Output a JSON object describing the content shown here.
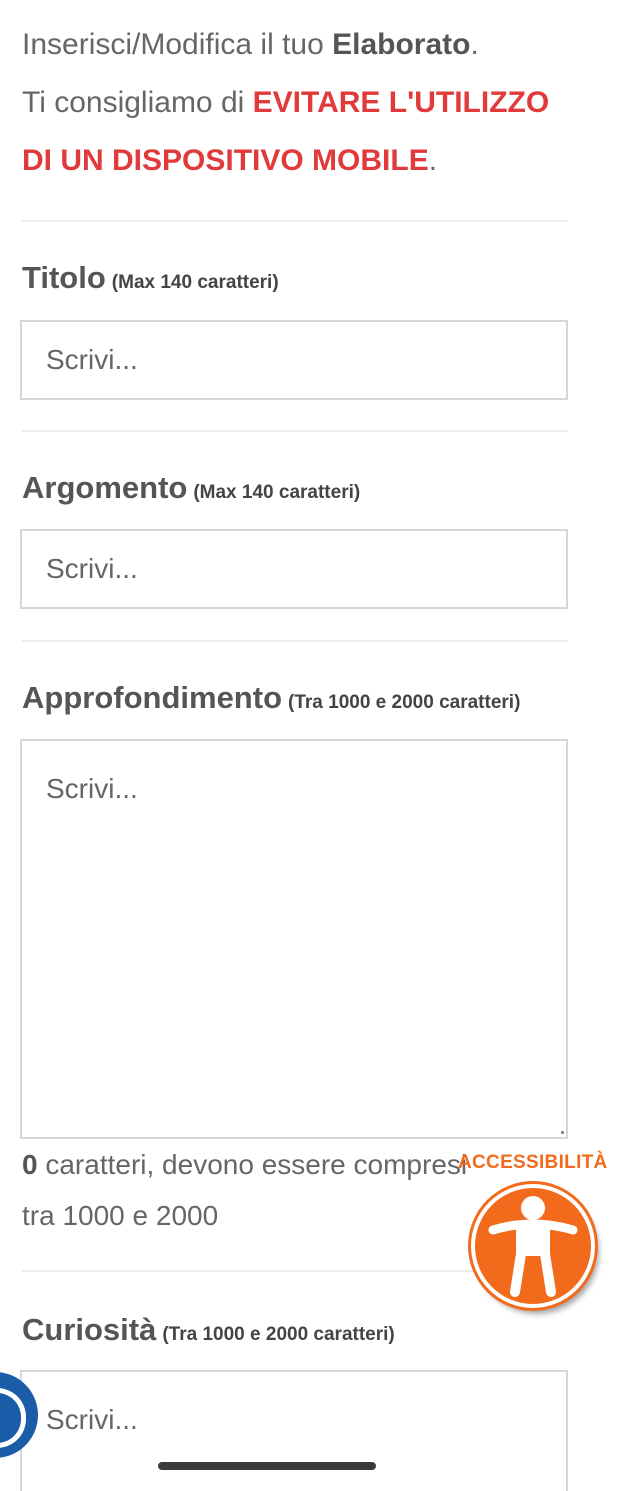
{
  "intro": {
    "line1_prefix": "Inserisci/Modifica il tuo ",
    "line1_bold": "Elaborato",
    "line1_suffix": ".",
    "line2_prefix": "Ti consigliamo di ",
    "line2_red": "EVITARE L'UTILIZZO",
    "line3_red": "DI UN DISPOSITIVO MOBILE",
    "line3_suffix": "."
  },
  "fields": {
    "titolo": {
      "label": "Titolo",
      "hint": "(Max 140 caratteri)",
      "placeholder": "Scrivi..."
    },
    "argomento": {
      "label": "Argomento",
      "hint": "(Max 140 caratteri)",
      "placeholder": "Scrivi..."
    },
    "approfondimento": {
      "label": "Approfondimento",
      "hint": "(Tra 1000 e 2000 caratteri)",
      "placeholder": "Scrivi...",
      "counter_value": "0",
      "counter_text_line1": " caratteri, devono essere compresi",
      "counter_text_line2": "tra 1000 e 2000"
    },
    "curiosita": {
      "label": "Curiosità",
      "hint": "(Tra 1000 e 2000 caratteri)",
      "placeholder": "Scrivi..."
    }
  },
  "accessibility": {
    "label": "ACCESSIBILITÀ",
    "icon": "accessibility-person-icon"
  },
  "colors": {
    "accent_red": "#e03a3a",
    "accessibility_orange": "#f26a1b",
    "badge_blue": "#1a5ca8"
  }
}
